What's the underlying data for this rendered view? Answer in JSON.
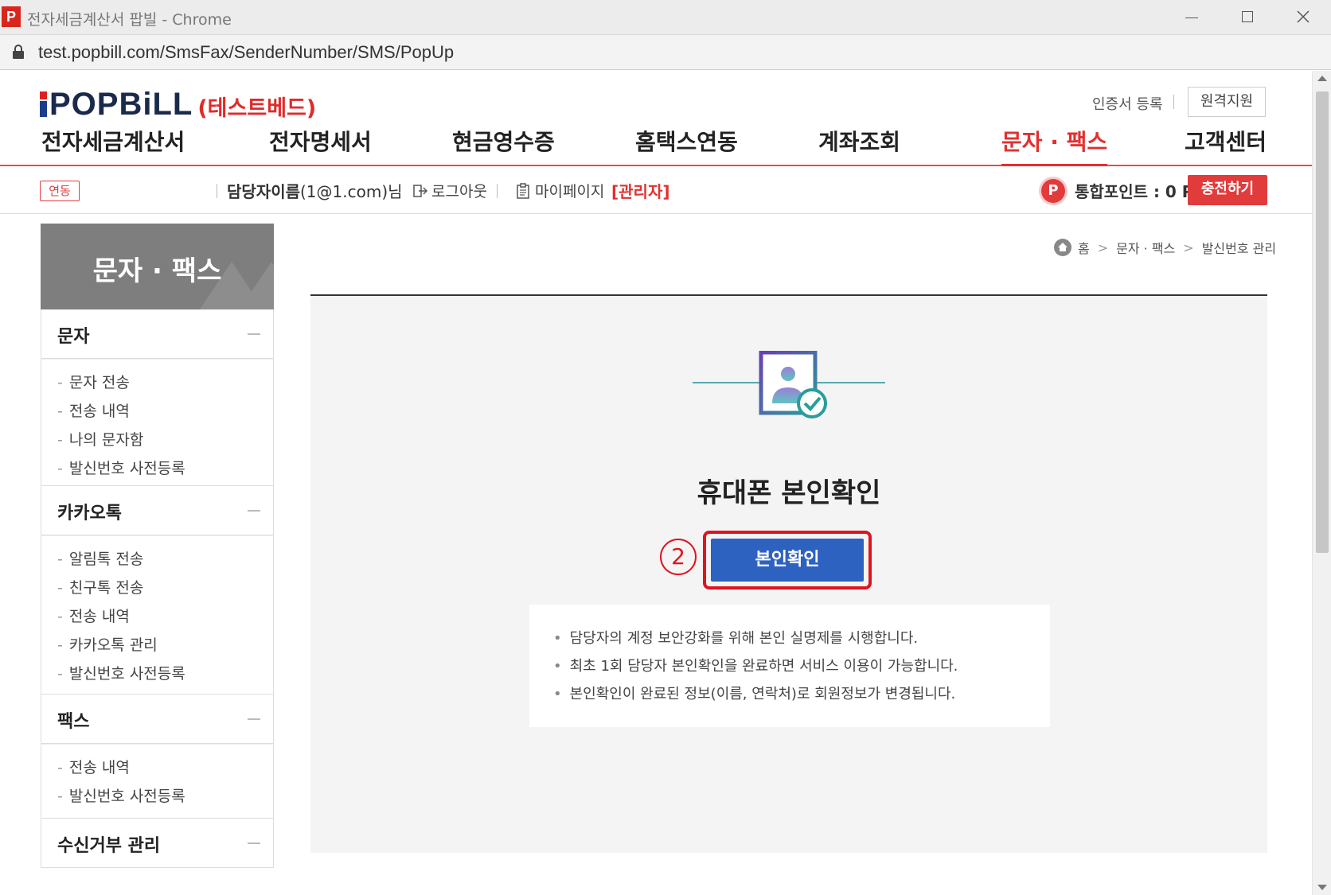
{
  "window": {
    "app_icon": "P",
    "title": "전자세금계산서 팝빌 - Chrome",
    "url": "test.popbill.com/SmsFax/SenderNumber/SMS/PopUp"
  },
  "header": {
    "logo_text": "POPBiLL",
    "logo_sub": "(테스트베드)",
    "cert_link": "인증서 등록",
    "remote_button": "원격지원"
  },
  "nav": {
    "items": [
      "전자세금계산서",
      "전자명세서",
      "현금영수증",
      "홈택스연동",
      "계좌조회",
      "문자 · 팩스",
      "고객센터"
    ],
    "active_index": 5
  },
  "infobar": {
    "link_badge": "연동",
    "manager_name": "담당자이름",
    "manager_email": "(1@1.com)",
    "manager_suffix": "님",
    "logout": "로그아웃",
    "mypage": "마이페이지",
    "admin": "[관리자]",
    "point_icon": "P",
    "point_label": "통합포인트 : 0 P",
    "charge_button": "충전하기"
  },
  "sidebar": {
    "title": "문자 · 팩스",
    "sections": [
      {
        "label": "문자",
        "items": [
          "문자 전송",
          "전송 내역",
          "나의 문자함",
          "발신번호 사전등록"
        ]
      },
      {
        "label": "카카오톡",
        "items": [
          "알림톡 전송",
          "친구톡 전송",
          "전송 내역",
          "카카오톡 관리",
          "발신번호 사전등록"
        ]
      },
      {
        "label": "팩스",
        "items": [
          "전송 내역",
          "발신번호 사전등록"
        ]
      },
      {
        "label": "수신거부 관리",
        "items": []
      }
    ]
  },
  "breadcrumb": {
    "home": "홈",
    "level1": "문자 · 팩스",
    "level2": "발신번호 관리"
  },
  "main": {
    "title": "휴대폰 본인확인",
    "verify_button": "본인확인",
    "step_marker": "2",
    "notices": [
      "담당자의 계정 보안강화를 위해 본인 실명제를 시행합니다.",
      "최초 1회 담당자 본인확인을 완료하면 서비스 이용이 가능합니다.",
      "본인확인이 완료된 정보(이름, 연락처)로 회원정보가 변경됩니다."
    ]
  },
  "colors": {
    "accent_red": "#e42f2f",
    "button_blue": "#2e62c1",
    "highlight_red": "#e0141e",
    "sidebar_head": "#7e7e7e"
  }
}
